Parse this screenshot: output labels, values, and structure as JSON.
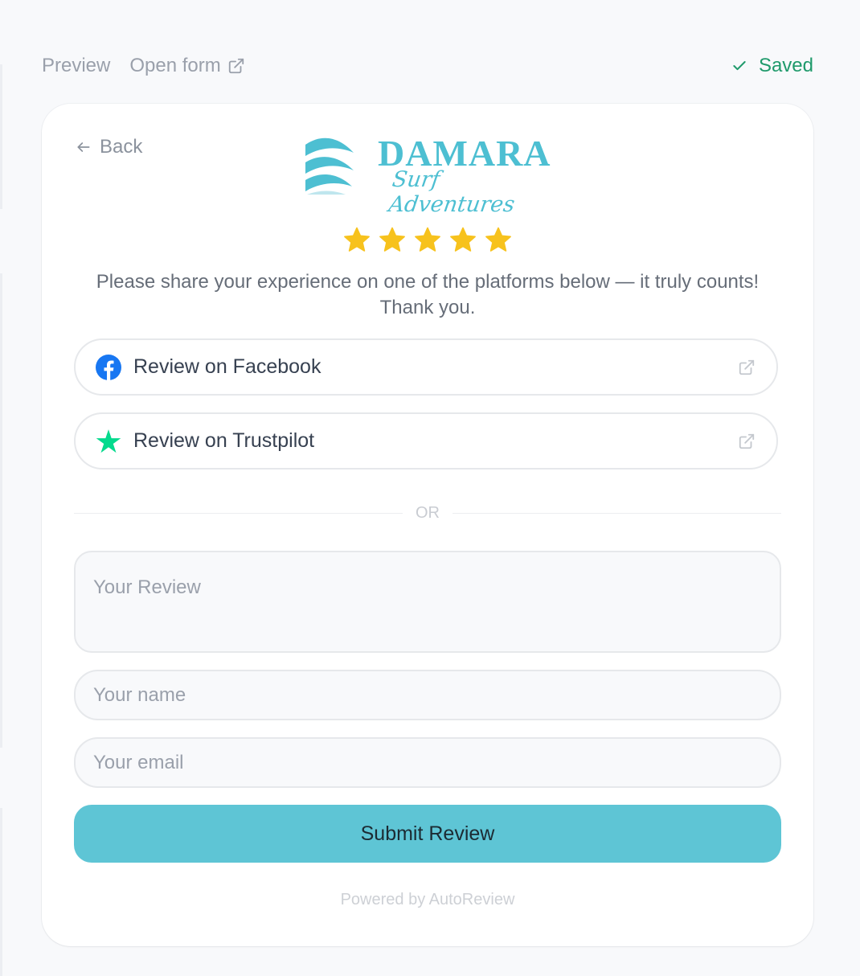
{
  "colors": {
    "accent": "#5ec5d5",
    "brand": "#4dbfd2",
    "saved": "#1f9a6b",
    "star": "#f7c21d",
    "facebook": "#1877f2",
    "trustpilot": "#04da8d"
  },
  "topbar": {
    "preview_label": "Preview",
    "open_form_label": "Open form",
    "saved_label": "Saved"
  },
  "back_label": "Back",
  "logo": {
    "title": "DAMARA",
    "subtitle": "Surf Adventures"
  },
  "rating": {
    "value": 5,
    "max": 5
  },
  "message": "Please share your experience on one of the platforms below — it truly counts! Thank you.",
  "platforms": [
    {
      "label": "Review on Facebook",
      "icon": "facebook-icon"
    },
    {
      "label": "Review on Trustpilot",
      "icon": "trustpilot-star-icon"
    }
  ],
  "divider_label": "OR",
  "form": {
    "review_placeholder": "Your Review",
    "name_placeholder": "Your name",
    "email_placeholder": "Your email",
    "submit_label": "Submit Review"
  },
  "footer": "Powered by AutoReview"
}
